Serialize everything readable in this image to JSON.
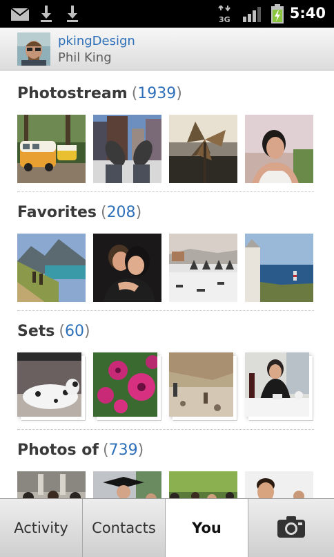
{
  "status_bar": {
    "time": "5:40",
    "network": "3G",
    "icons": [
      "mail-icon",
      "download-icon",
      "download-icon",
      "network-3g-icon",
      "signal-icon",
      "battery-charging-icon"
    ]
  },
  "profile": {
    "username": "pkingDesign",
    "real_name": "Phil King"
  },
  "sections": [
    {
      "title": "Photostream",
      "count": "1939",
      "thumbnails": [
        "vw-van-camping",
        "feet-city-rooftop",
        "pinwheel-dusk",
        "woman-portrait"
      ]
    },
    {
      "title": "Favorites",
      "count": "208",
      "thumbnails": [
        "mountain-lake-hikers",
        "couple-laughing",
        "winter-village",
        "lighthouse-cliffs"
      ]
    },
    {
      "title": "Sets",
      "count": "60",
      "thumbnails": [
        "dalmatian-dog",
        "pink-flowers",
        "rocky-beach",
        "dinner-table"
      ]
    },
    {
      "title": "Photos of",
      "count": "739",
      "thumbnails": [
        "crowd-building",
        "graduation-crowd",
        "outdoor-group",
        "smiling-man"
      ]
    }
  ],
  "tabs": [
    {
      "label": "Activity",
      "active": false
    },
    {
      "label": "Contacts",
      "active": false
    },
    {
      "label": "You",
      "active": true
    },
    {
      "label": "",
      "icon": "camera-icon",
      "active": false
    }
  ],
  "colors": {
    "link_blue": "#2d6fb8",
    "title_gray": "#3a3a3a",
    "status_bar": "#000000"
  }
}
